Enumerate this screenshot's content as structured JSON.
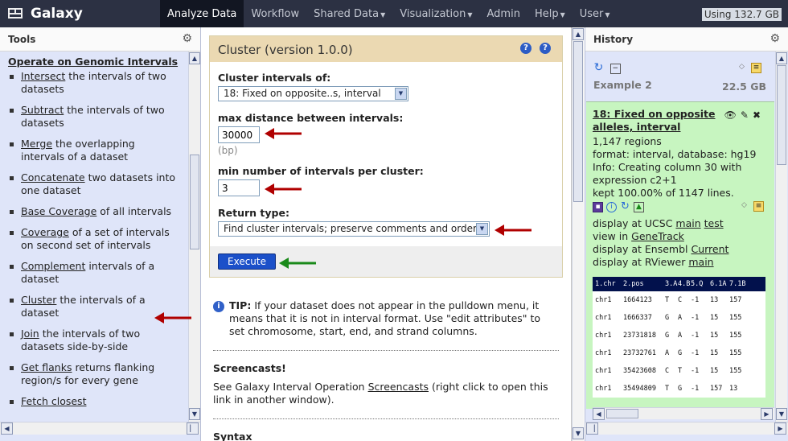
{
  "app": {
    "brand": "Galaxy",
    "nav": [
      {
        "label": "Analyze Data",
        "active": true,
        "caret": false
      },
      {
        "label": "Workflow",
        "active": false,
        "caret": false
      },
      {
        "label": "Shared Data",
        "active": false,
        "caret": true
      },
      {
        "label": "Visualization",
        "active": false,
        "caret": true
      },
      {
        "label": "Admin",
        "active": false,
        "caret": false
      },
      {
        "label": "Help",
        "active": false,
        "caret": true
      },
      {
        "label": "User",
        "active": false,
        "caret": true
      }
    ],
    "usage": "Using 132.7 GB"
  },
  "tools_panel": {
    "title": "Tools",
    "section_title": "Operate on Genomic Intervals",
    "tools": [
      {
        "link": "Intersect",
        "desc": " the intervals of two datasets"
      },
      {
        "link": "Subtract",
        "desc": " the intervals of two datasets"
      },
      {
        "link": "Merge",
        "desc": " the overlapping intervals of a dataset"
      },
      {
        "link": "Concatenate",
        "desc": " two datasets into one dataset"
      },
      {
        "link": "Base Coverage",
        "desc": " of all intervals"
      },
      {
        "link": "Coverage",
        "desc": " of a set of intervals on second set of intervals"
      },
      {
        "link": "Complement",
        "desc": " intervals of a dataset"
      },
      {
        "link": "Cluster",
        "desc": " the intervals of a dataset"
      },
      {
        "link": "Join",
        "desc": " the intervals of two datasets side-by-side"
      },
      {
        "link": "Get flanks",
        "desc": " returns flanking region/s for every gene"
      },
      {
        "link": "Fetch closest",
        "desc": ""
      }
    ]
  },
  "tool_form": {
    "title": "Cluster (version 1.0.0)",
    "cluster_of_label": "Cluster intervals of:",
    "cluster_of_value": "18: Fixed on opposite..s, interval",
    "max_distance_label": "max distance between intervals:",
    "max_distance_value": "30000",
    "max_distance_hint": "(bp)",
    "min_intervals_label": "min number of intervals per cluster:",
    "min_intervals_value": "3",
    "return_type_label": "Return type:",
    "return_type_value": "Find cluster intervals; preserve comments and order",
    "execute_label": "Execute"
  },
  "help": {
    "tip_bold": "TIP:",
    "tip_text": " If your dataset does not appear in the pulldown menu, it means that it is not in interval format. Use \"edit attributes\" to set chromosome, start, end, and strand columns.",
    "screencasts_heading": "Screencasts!",
    "screencasts_pre": "See Galaxy Interval Operation ",
    "screencasts_link": "Screencasts",
    "screencasts_post": " (right click to open this link in another window).",
    "next_heading": "Syntax"
  },
  "history": {
    "title": "History",
    "name": "Example 2",
    "size": "22.5 GB",
    "dataset": {
      "title": "18: Fixed on opposite alleles, interval",
      "regions": "1,147 regions",
      "format_line": "format: interval, database: hg19",
      "info_line": "Info: Creating column 30 with expression c2+1",
      "kept_line": "kept 100.00% of 1147 lines.",
      "ucsc_pre": "display at UCSC ",
      "ucsc_main": "main",
      "ucsc_test": "test",
      "genetrack_pre": "view in ",
      "genetrack_link": "GeneTrack",
      "ensembl_pre": "display at Ensembl ",
      "ensembl_link": "Current",
      "rviewer_pre": "display at RViewer ",
      "rviewer_link": "main"
    },
    "peek_header": [
      "1.chr",
      "2.pos",
      "3.A",
      "4.B",
      "5.Q",
      "6.1A",
      "7.1B"
    ],
    "peek_rows": [
      [
        "chr1",
        "1664123",
        "T",
        "C",
        "-1",
        "13",
        "157"
      ],
      [
        "chr1",
        "1666337",
        "G",
        "A",
        "-1",
        "15",
        "155"
      ],
      [
        "chr1",
        "23731818",
        "G",
        "A",
        "-1",
        "15",
        "155"
      ],
      [
        "chr1",
        "23732761",
        "A",
        "G",
        "-1",
        "15",
        "155"
      ],
      [
        "chr1",
        "35423608",
        "C",
        "T",
        "-1",
        "15",
        "155"
      ],
      [
        "chr1",
        "35494809",
        "T",
        "G",
        "-1",
        "157",
        "13"
      ]
    ]
  },
  "colors": {
    "topbar": "#2c3143",
    "panel_bg": "#dfe5f9",
    "dataset_ok": "#c7f5c0",
    "form_title_bg": "#ebd9b2",
    "execute": "#1b50c9",
    "arrow_red": "#b00000",
    "arrow_green": "#1a8a1a"
  }
}
